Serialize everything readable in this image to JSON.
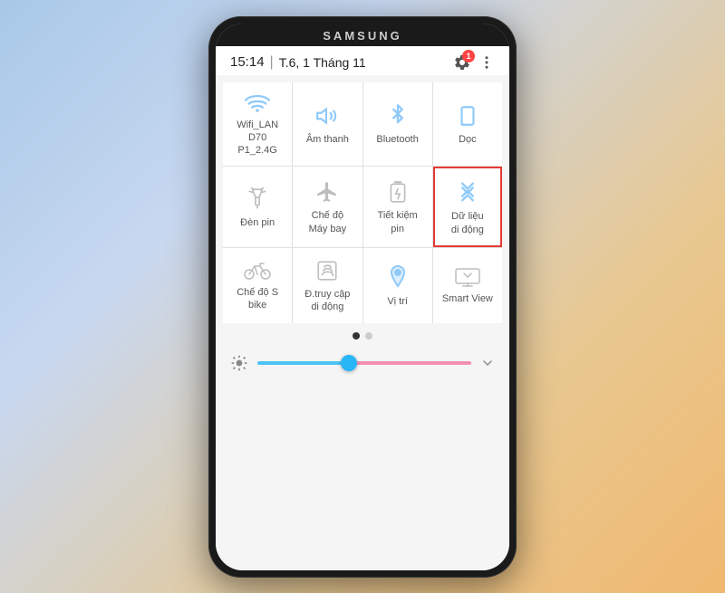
{
  "phone": {
    "brand": "SAMSUNG",
    "status": {
      "time": "15:14",
      "divider": "|",
      "date": "T.6, 1 Tháng 11",
      "badge": "1"
    },
    "tiles": [
      {
        "id": "wifi",
        "label": "Wifi_LAN D70\nP1_2.4G",
        "icon": "wifi",
        "highlighted": false
      },
      {
        "id": "sound",
        "label": "Âm thanh",
        "icon": "sound",
        "highlighted": false
      },
      {
        "id": "bluetooth",
        "label": "Bluetooth",
        "icon": "bluetooth",
        "highlighted": false
      },
      {
        "id": "doc",
        "label": "Dọc",
        "icon": "rotation",
        "highlighted": false
      },
      {
        "id": "flashlight",
        "label": "Đèn pin",
        "icon": "flashlight",
        "highlighted": false
      },
      {
        "id": "airplane",
        "label": "Chế độ\nMáy bay",
        "icon": "airplane",
        "highlighted": false
      },
      {
        "id": "battery",
        "label": "Tiết kiệm\npin",
        "icon": "battery",
        "highlighted": false
      },
      {
        "id": "mobile-data",
        "label": "Dữ liệu\ndi động",
        "icon": "data",
        "highlighted": true
      },
      {
        "id": "sbike",
        "label": "Chế độ S bike",
        "icon": "bike",
        "highlighted": false
      },
      {
        "id": "mobile-access",
        "label": "Đ.truy cập\ndi động",
        "icon": "share",
        "highlighted": false
      },
      {
        "id": "location",
        "label": "Vị trí",
        "icon": "location",
        "highlighted": false
      },
      {
        "id": "smartview",
        "label": "Smart View",
        "icon": "smartview",
        "highlighted": false
      }
    ],
    "dots": {
      "active": 0,
      "total": 2
    },
    "brightness": {
      "value": 45
    }
  }
}
